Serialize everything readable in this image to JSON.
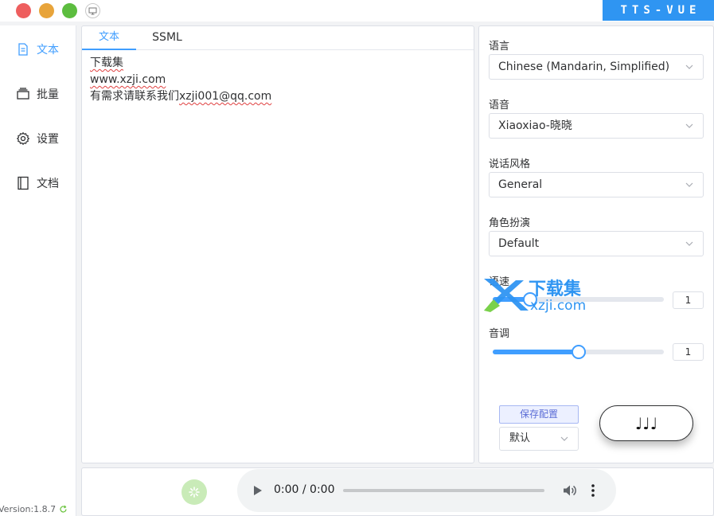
{
  "app": {
    "brand": "TTS-VUE",
    "version": "Version:1.8.7"
  },
  "sidebar": {
    "items": [
      {
        "label": "文本",
        "icon": "document-icon",
        "active": true
      },
      {
        "label": "批量",
        "icon": "stack-icon"
      },
      {
        "label": "设置",
        "icon": "gear-icon"
      },
      {
        "label": "文档",
        "icon": "notebook-icon"
      }
    ]
  },
  "editor": {
    "tabs": [
      "文本",
      "SSML"
    ],
    "lines": [
      "下载集",
      "www.xzji.com",
      "有需求请联系我们",
      "xzji001@qq.com"
    ]
  },
  "settings": {
    "language_label": "语言",
    "language_value": "Chinese (Mandarin, Simplified)",
    "voice_label": "语音",
    "voice_value": "Xiaoxiao-晓晓",
    "style_label": "说话风格",
    "style_value": "General",
    "role_label": "角色扮演",
    "role_value": "Default",
    "speed_label": "语速",
    "speed_value": "1",
    "speed_fraction": 0.22,
    "pitch_label": "音调",
    "pitch_value": "1",
    "pitch_fraction": 0.5,
    "save_label": "保存配置",
    "preset_value": "默认",
    "play_notes": "♩♩♩"
  },
  "watermark": {
    "title": "下载集",
    "url": "xzji.com"
  },
  "player": {
    "time": "0:00 / 0:00"
  },
  "colors": {
    "accent": "#409eff",
    "brand_bg": "#2f95f2"
  }
}
